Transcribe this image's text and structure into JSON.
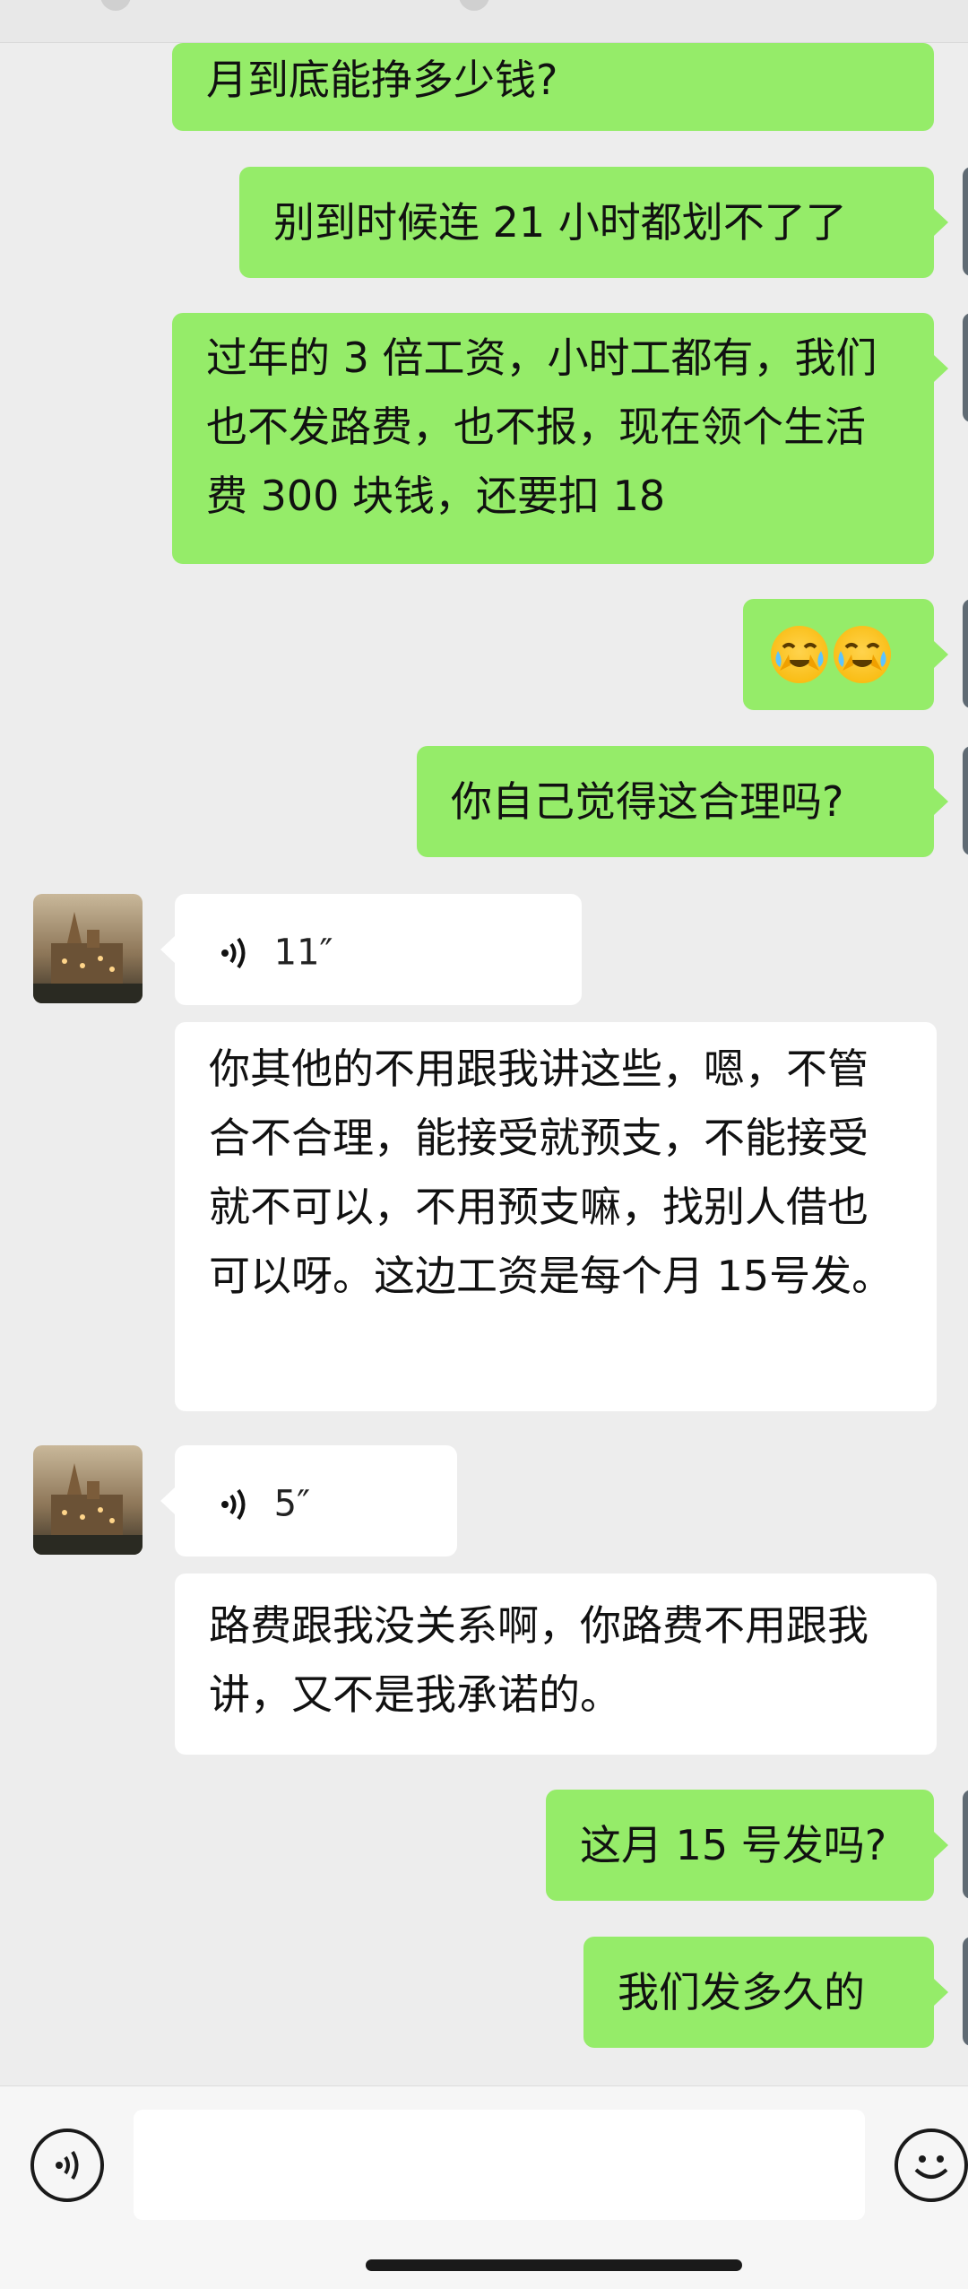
{
  "messages": [
    {
      "sender": "me",
      "text": "月到底能挣多少钱?"
    },
    {
      "sender": "me",
      "text": "别到时候连 21 小时都划不了了"
    },
    {
      "sender": "me",
      "text": "过年的 3 倍工资，小时工都有，我们也不发路费，也不报，现在领个生活费 300 块钱，还要扣 18"
    },
    {
      "sender": "me",
      "emoji": "cry-laugh-emoji x2"
    },
    {
      "sender": "me",
      "text": "你自己觉得这合理吗?"
    },
    {
      "sender": "them",
      "voice_duration": "11″"
    },
    {
      "sender": "them",
      "text": "你其他的不用跟我讲这些，嗯，不管合不合理，能接受就预支，不能接受就不可以，不用预支嘛，找别人借也可以呀。这边工资是每个月 15号发。"
    },
    {
      "sender": "them",
      "voice_duration": "5″"
    },
    {
      "sender": "them",
      "text": "路费跟我没关系啊，你路费不用跟我讲，又不是我承诺的。"
    },
    {
      "sender": "me",
      "text": "这月 15 号发吗?"
    },
    {
      "sender": "me",
      "text": "我们发多久的"
    }
  ],
  "input": {
    "value": ""
  },
  "colors": {
    "me_bubble": "#95ec69",
    "them_bubble": "#ffffff",
    "background": "#ededed"
  },
  "icons": {
    "voice_toggle": "voice-input-icon",
    "emoji": "emoji-icon",
    "voice_wave": "voice-wave-icon"
  }
}
